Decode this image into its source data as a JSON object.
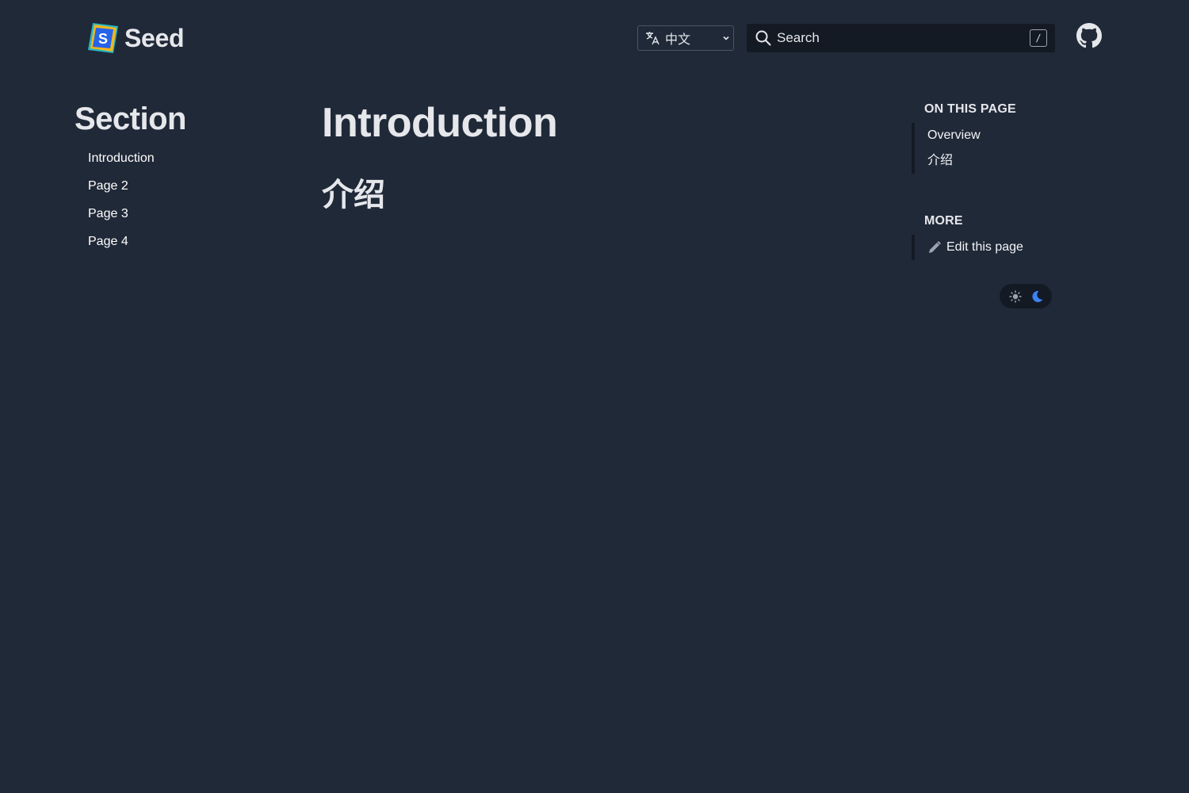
{
  "header": {
    "brand": "Seed",
    "language": {
      "selected": "中文"
    },
    "search": {
      "placeholder": "Search",
      "shortcut": "/"
    }
  },
  "sidebar": {
    "title": "Section",
    "items": [
      {
        "label": "Introduction"
      },
      {
        "label": "Page 2"
      },
      {
        "label": "Page 3"
      },
      {
        "label": "Page 4"
      }
    ]
  },
  "main": {
    "title": "Introduction",
    "heading": "介绍"
  },
  "toc": {
    "on_this_page_label": "ON THIS PAGE",
    "items": [
      {
        "label": "Overview"
      },
      {
        "label": "介绍"
      }
    ],
    "more_label": "MORE",
    "edit_label": "Edit this page"
  },
  "colors": {
    "background": "#202938",
    "panel": "#141a24",
    "text": "#e5e7eb",
    "accent_moon": "#3b82f6",
    "logo_yellow": "#f5b51a",
    "logo_blue": "#2563eb",
    "logo_teal": "#22b7c9"
  },
  "icons": [
    "seed-logo-icon",
    "translate-icon",
    "chevron-down-icon",
    "search-icon",
    "github-icon",
    "pencil-icon",
    "sun-icon",
    "moon-icon"
  ]
}
